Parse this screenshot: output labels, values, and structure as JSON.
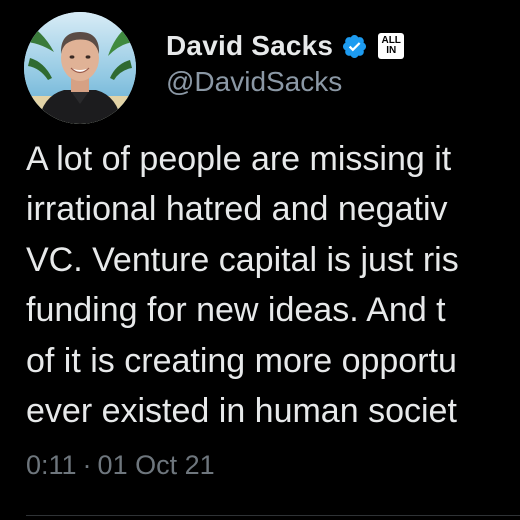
{
  "author": {
    "display_name": "David Sacks",
    "handle": "@DavidSacks",
    "verified": true,
    "affiliate_badge": {
      "line1": "ALL",
      "line2": "IN"
    }
  },
  "tweet": {
    "lines": [
      "A lot of people are missing it",
      "irrational hatred and negativ",
      "VC. Venture capital is just ris",
      "funding for new ideas. And t",
      "of it is creating more opportu",
      "ever existed in human societ"
    ],
    "time": "0:11",
    "separator": "·",
    "date": "01 Oct 21"
  },
  "colors": {
    "background": "#000000",
    "text": "#e7e9ea",
    "secondary": "#8b98a5",
    "meta": "#6e767d",
    "verified": "#1d9bf0"
  },
  "icons": {
    "verified": "verified-badge-icon",
    "affiliate": "all-in-affiliate-icon"
  }
}
